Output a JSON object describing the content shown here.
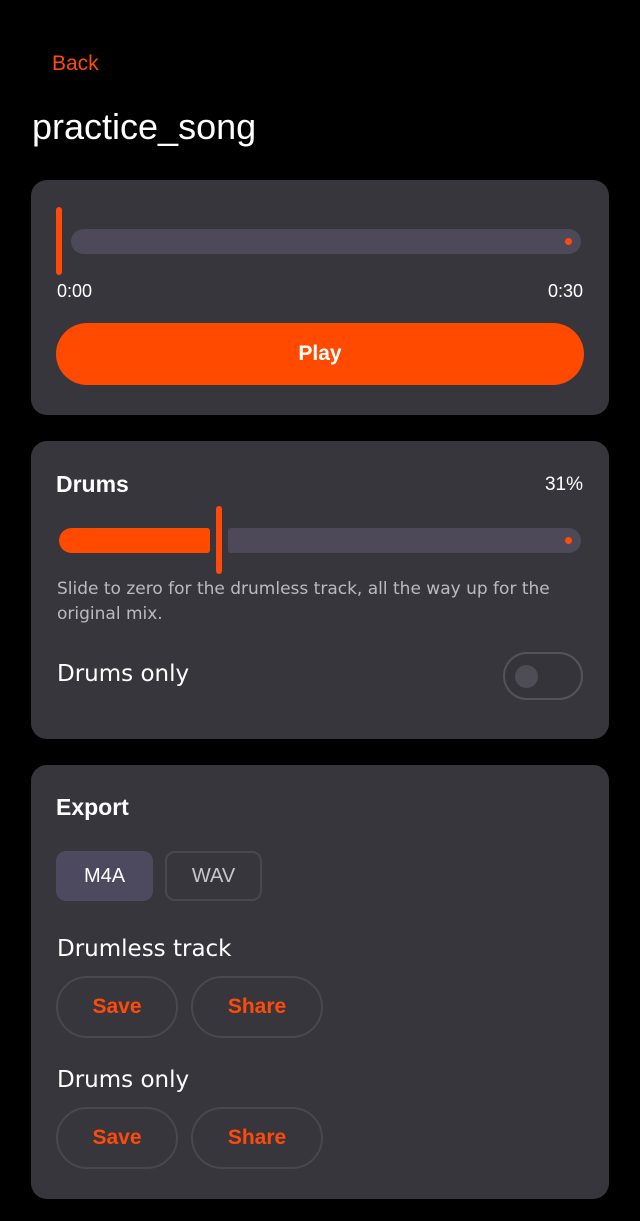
{
  "header": {
    "back_label": "Back",
    "title": "practice_song"
  },
  "player": {
    "current_time": "0:00",
    "duration": "0:30",
    "progress": 0,
    "play_label": "Play"
  },
  "drums": {
    "heading": "Drums",
    "level_label": "31%",
    "level": 0.31,
    "help_text": "Slide to zero for the drumless track, all the way up for the original mix.",
    "drums_only_label": "Drums only",
    "drums_only_enabled": false
  },
  "export": {
    "heading": "Export",
    "formats": [
      "M4A",
      "WAV"
    ],
    "selected_format": "M4A",
    "groups": [
      {
        "label": "Drumless track",
        "save_label": "Save",
        "share_label": "Share"
      },
      {
        "label": "Drums only",
        "save_label": "Save",
        "share_label": "Share"
      }
    ]
  },
  "colors": {
    "accent": "#ff4a00",
    "background": "#000000",
    "card": "#37363d",
    "track_inactive": "#4d4959",
    "selected_tab": "#4d495e"
  },
  "icons": {
    "toggle": "toggle-off-icon"
  }
}
